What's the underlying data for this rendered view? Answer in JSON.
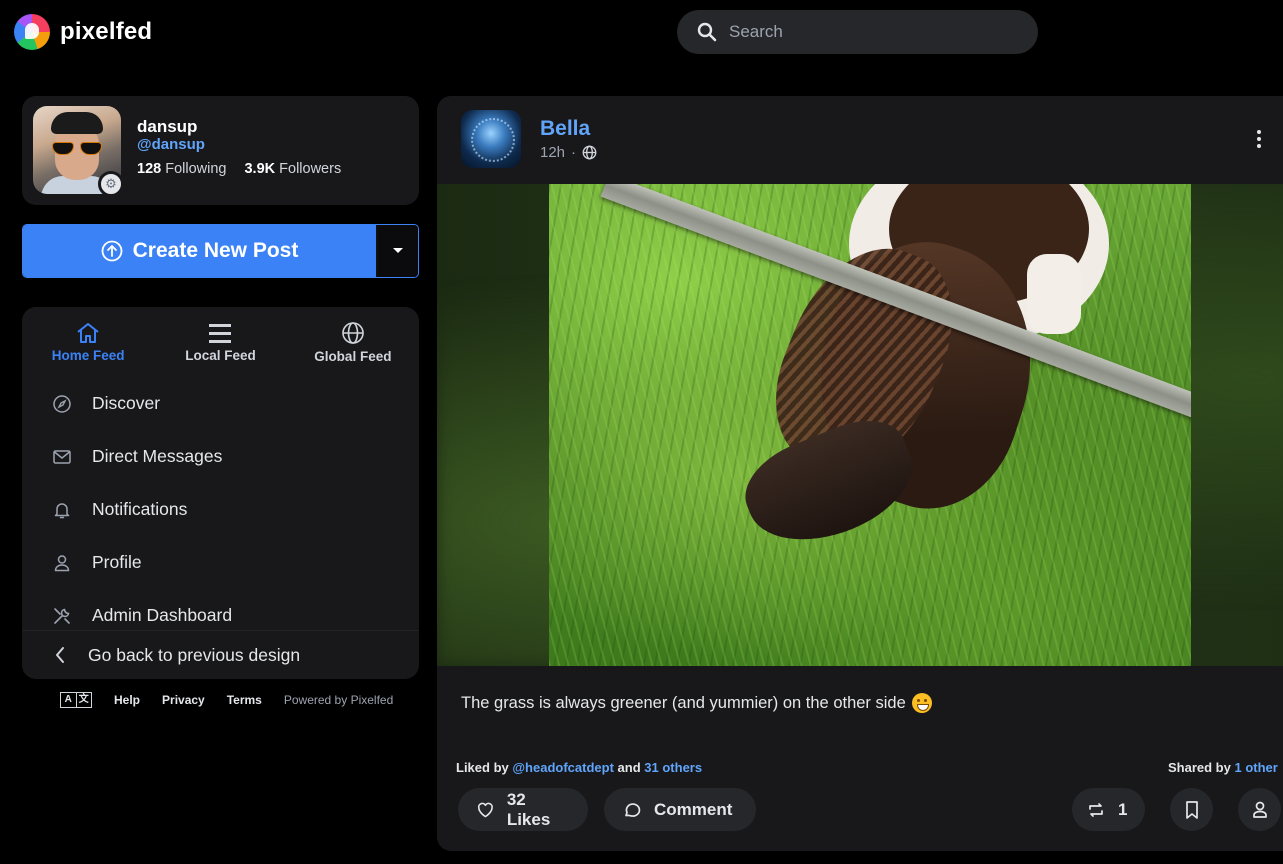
{
  "app": {
    "brand": "pixelfed",
    "accent": "#3b82f6",
    "link_color": "#60a5fa"
  },
  "search": {
    "placeholder": "Search"
  },
  "profile": {
    "name": "dansup",
    "handle": "@dansup",
    "following_count": "128",
    "following_label": "Following",
    "followers_count": "3.9K",
    "followers_label": "Followers"
  },
  "create": {
    "label": "Create New Post"
  },
  "feeds": [
    {
      "label": "Home Feed",
      "icon": "home-icon",
      "active": true
    },
    {
      "label": "Local Feed",
      "icon": "list-icon",
      "active": false
    },
    {
      "label": "Global Feed",
      "icon": "globe-icon",
      "active": false
    }
  ],
  "nav": {
    "items": [
      {
        "label": "Discover",
        "icon": "compass-icon"
      },
      {
        "label": "Direct Messages",
        "icon": "envelope-icon"
      },
      {
        "label": "Notifications",
        "icon": "bell-icon"
      },
      {
        "label": "Profile",
        "icon": "user-icon"
      },
      {
        "label": "Admin Dashboard",
        "icon": "tools-icon"
      }
    ],
    "back_label": "Go back to previous design"
  },
  "footer": {
    "help": "Help",
    "privacy": "Privacy",
    "terms": "Terms",
    "powered": "Powered by Pixelfed",
    "lang_left": "A",
    "lang_right": "文"
  },
  "post": {
    "author": "Bella",
    "time": "12h",
    "visibility_icon": "globe-icon",
    "caption": "The grass is always greener (and yummier) on the other side",
    "liked_prefix": "Liked by",
    "liked_user": "@headofcatdept",
    "liked_and": "and",
    "liked_others": "31 others",
    "shared_prefix": "Shared by",
    "shared_others": "1 other",
    "likes_label": "32 Likes",
    "comment_label": "Comment",
    "shares_count": "1"
  }
}
